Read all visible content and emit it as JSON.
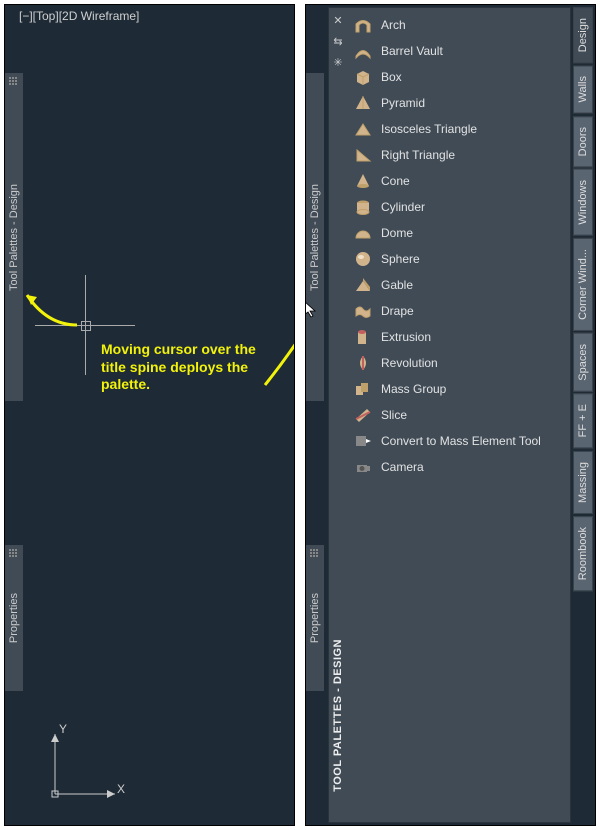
{
  "left": {
    "view_label": "[−][Top][2D Wireframe]",
    "spine_tool_palettes": "Tool Palettes - Design",
    "spine_properties": "Properties",
    "annotation": "Moving cursor over the title spine deploys the palette.",
    "ucs": {
      "x": "X",
      "y": "Y"
    }
  },
  "right": {
    "spine_tool_palettes": "Tool Palettes - Design",
    "spine_properties": "Properties",
    "spine_big": "TOOL PALETTES - DESIGN",
    "controls": {
      "close": "✕",
      "arrows": "⇆",
      "gear": "✳"
    },
    "tools": [
      {
        "label": "Arch",
        "icon": "arch"
      },
      {
        "label": "Barrel Vault",
        "icon": "barrel"
      },
      {
        "label": "Box",
        "icon": "box"
      },
      {
        "label": "Pyramid",
        "icon": "pyramid"
      },
      {
        "label": "Isosceles Triangle",
        "icon": "iso"
      },
      {
        "label": "Right Triangle",
        "icon": "rtri"
      },
      {
        "label": "Cone",
        "icon": "cone"
      },
      {
        "label": "Cylinder",
        "icon": "cyl"
      },
      {
        "label": "Dome",
        "icon": "dome"
      },
      {
        "label": "Sphere",
        "icon": "sphere"
      },
      {
        "label": "Gable",
        "icon": "gable"
      },
      {
        "label": "Drape",
        "icon": "drape"
      },
      {
        "label": "Extrusion",
        "icon": "extrude"
      },
      {
        "label": "Revolution",
        "icon": "rev"
      },
      {
        "label": "Mass Group",
        "icon": "mgroup"
      },
      {
        "label": "Slice",
        "icon": "slice"
      },
      {
        "label": "Convert to Mass Element Tool",
        "icon": "convert"
      },
      {
        "label": "Camera",
        "icon": "camera"
      }
    ],
    "tabs": [
      {
        "label": "Design",
        "active": true
      },
      {
        "label": "Walls"
      },
      {
        "label": "Doors"
      },
      {
        "label": "Windows"
      },
      {
        "label": "Corner Wind..."
      },
      {
        "label": "Spaces"
      },
      {
        "label": "FF + E"
      },
      {
        "label": "Massing"
      },
      {
        "label": "Roombook"
      }
    ]
  }
}
